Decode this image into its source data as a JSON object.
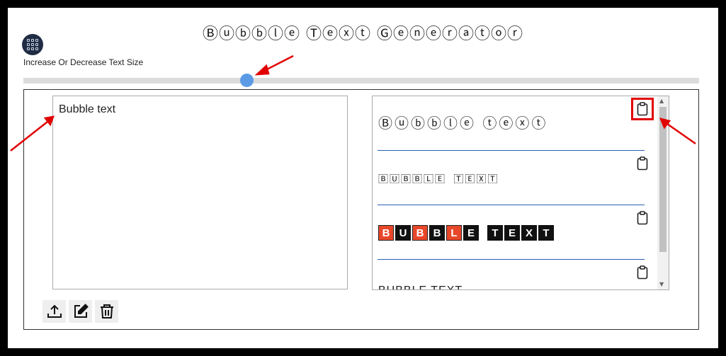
{
  "title": "Ⓑⓤⓑⓑⓛⓔ Ⓣⓔⓧⓣ Ⓖⓔⓝⓔⓡⓐⓣⓞⓡ",
  "size_label": "Increase Or Decrease Text Size",
  "slider": {
    "value": 0.33
  },
  "input": {
    "value": "Bubble text"
  },
  "results": [
    {
      "text": "Ⓑⓤⓑⓑⓛⓔ ⓣⓔⓧⓣ",
      "copy_icon": "clipboard-icon"
    },
    {
      "text": "🄱🅄🄱🄱🄻🄴 🅃🄴🅇🅃",
      "copy_icon": "clipboard-icon"
    },
    {
      "letters": [
        "B",
        "U",
        "B",
        "B",
        "L",
        "E",
        " ",
        "T",
        "E",
        "X",
        "T"
      ],
      "red_indices": [
        0,
        2,
        4
      ],
      "copy_icon": "clipboard-icon"
    },
    {
      "text": "BUBBLE TEXT",
      "copy_icon": "clipboard-icon"
    }
  ],
  "tools": {
    "upload_icon": "upload-icon",
    "edit_icon": "edit-icon",
    "delete_icon": "trash-icon"
  },
  "colors": {
    "accent": "#5b9be6",
    "menu_bg": "#1f2c44",
    "annotation": "#e10000",
    "separator": "#2a5fb0"
  }
}
